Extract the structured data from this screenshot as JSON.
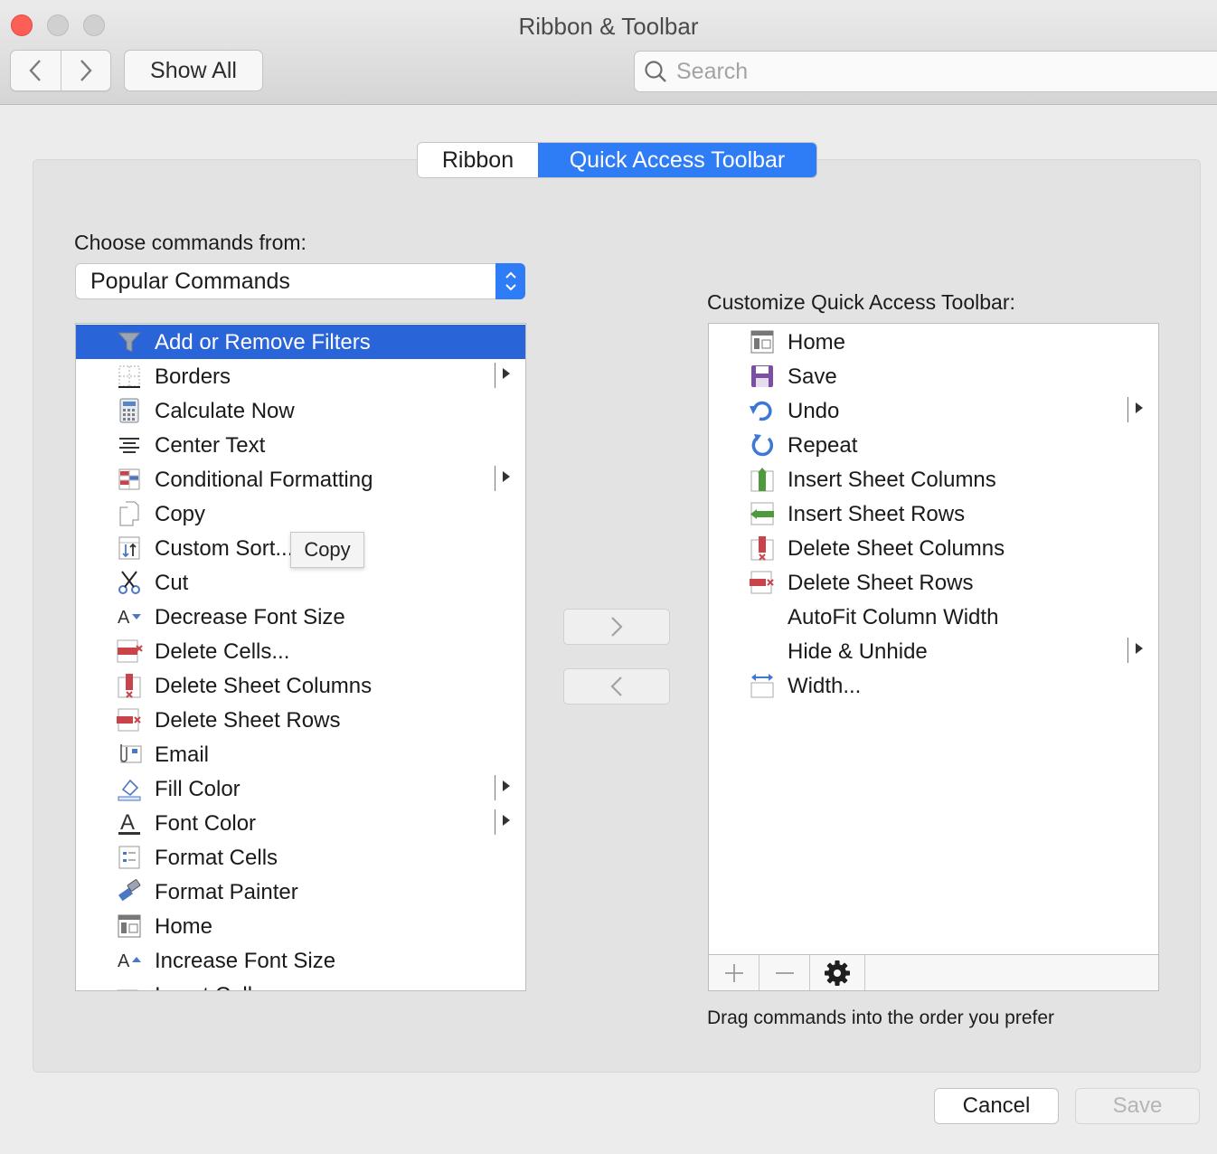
{
  "window": {
    "title": "Ribbon & Toolbar"
  },
  "toolbar": {
    "show_all_label": "Show All",
    "search_placeholder": "Search"
  },
  "tabs": [
    {
      "label": "Ribbon",
      "active": false
    },
    {
      "label": "Quick Access Toolbar",
      "active": true
    }
  ],
  "left": {
    "heading": "Choose commands from:",
    "dropdown_value": "Popular Commands",
    "items": [
      {
        "label": "Add or Remove Filters",
        "icon": "filter-icon",
        "selected": true
      },
      {
        "label": "Borders",
        "icon": "borders-icon",
        "submenu": true
      },
      {
        "label": "Calculate Now",
        "icon": "calculator-icon"
      },
      {
        "label": "Center Text",
        "icon": "center-text-icon"
      },
      {
        "label": "Conditional Formatting",
        "icon": "conditional-formatting-icon",
        "submenu": true
      },
      {
        "label": "Copy",
        "icon": "copy-icon"
      },
      {
        "label": "Custom Sort...",
        "icon": "custom-sort-icon"
      },
      {
        "label": "Cut",
        "icon": "scissors-icon"
      },
      {
        "label": "Decrease Font Size",
        "icon": "decrease-font-icon"
      },
      {
        "label": "Delete Cells...",
        "icon": "delete-cells-icon"
      },
      {
        "label": "Delete Sheet Columns",
        "icon": "delete-columns-icon"
      },
      {
        "label": "Delete Sheet Rows",
        "icon": "delete-rows-icon"
      },
      {
        "label": "Email",
        "icon": "email-icon"
      },
      {
        "label": "Fill Color",
        "icon": "fill-color-icon",
        "submenu": true
      },
      {
        "label": "Font Color",
        "icon": "font-color-icon",
        "submenu": true
      },
      {
        "label": "Format Cells",
        "icon": "format-cells-icon"
      },
      {
        "label": "Format Painter",
        "icon": "format-painter-icon"
      },
      {
        "label": "Home",
        "icon": "home-icon"
      },
      {
        "label": "Increase Font Size",
        "icon": "increase-font-icon"
      },
      {
        "label": "Insert Cells...",
        "icon": "insert-cells-icon"
      }
    ],
    "tooltip": "Copy"
  },
  "right": {
    "heading": "Customize Quick Access Toolbar:",
    "items": [
      {
        "label": "Home",
        "icon": "home-icon"
      },
      {
        "label": "Save",
        "icon": "save-icon"
      },
      {
        "label": "Undo",
        "icon": "undo-icon",
        "submenu": true
      },
      {
        "label": "Repeat",
        "icon": "repeat-icon"
      },
      {
        "label": "Insert Sheet Columns",
        "icon": "insert-columns-icon"
      },
      {
        "label": "Insert Sheet Rows",
        "icon": "insert-rows-icon"
      },
      {
        "label": "Delete Sheet Columns",
        "icon": "delete-columns-icon"
      },
      {
        "label": "Delete Sheet Rows",
        "icon": "delete-rows-icon"
      },
      {
        "label": "AutoFit Column Width",
        "icon": ""
      },
      {
        "label": "Hide & Unhide",
        "icon": "",
        "submenu": true
      },
      {
        "label": "Width...",
        "icon": "width-icon"
      }
    ],
    "hint": "Drag commands into the order you prefer"
  },
  "buttons": {
    "cancel": "Cancel",
    "save": "Save"
  },
  "colors": {
    "accent": "#2e7cf6",
    "selection": "#2a64d9",
    "close": "#fd5f57"
  }
}
